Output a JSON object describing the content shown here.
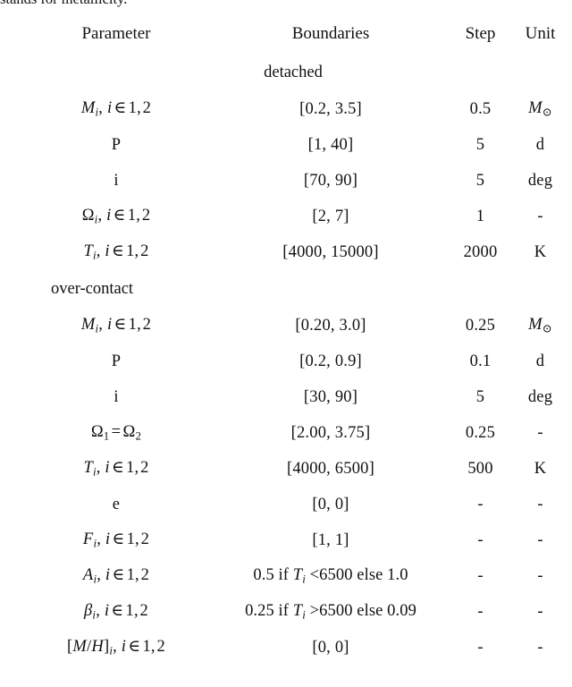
{
  "caption_fragment": "stands for metallicity.",
  "table": {
    "columns": [
      "Parameter",
      "Boundaries",
      "Step",
      "Unit"
    ],
    "sections": [
      {
        "label": "detached",
        "label_align": "center",
        "rows": [
          {
            "parameter_html": "M_i_set",
            "parameter_text": "M_i, i ∈ 1,2",
            "boundaries": "[0.2, 3.5]",
            "step": "0.5",
            "unit": "M_sun"
          },
          {
            "parameter_html": "P",
            "parameter_text": "P",
            "boundaries": "[1, 40]",
            "step": "5",
            "unit": "d"
          },
          {
            "parameter_html": "i",
            "parameter_text": "i",
            "boundaries": "[70, 90]",
            "step": "5",
            "unit": "deg"
          },
          {
            "parameter_html": "Omega_i_set",
            "parameter_text": "Ω_i, i ∈ 1,2",
            "boundaries": "[2, 7]",
            "step": "1",
            "unit": "-"
          },
          {
            "parameter_html": "T_i_set",
            "parameter_text": "T_i, i ∈ 1,2",
            "boundaries": "[4000, 15000]",
            "step": "2000",
            "unit": "K"
          }
        ]
      },
      {
        "label": "over-contact",
        "label_align": "left",
        "rows": [
          {
            "parameter_html": "M_i_set",
            "parameter_text": "M_i, i ∈ 1,2",
            "boundaries": "[0.20, 3.0]",
            "step": "0.25",
            "unit": "M_sun"
          },
          {
            "parameter_html": "P",
            "parameter_text": "P",
            "boundaries": "[0.2, 0.9]",
            "step": "0.1",
            "unit": "d"
          },
          {
            "parameter_html": "i",
            "parameter_text": "i",
            "boundaries": "[30, 90]",
            "step": "5",
            "unit": "deg"
          },
          {
            "parameter_html": "Omega_eq",
            "parameter_text": "Ω_1 = Ω_2",
            "boundaries": "[2.00, 3.75]",
            "step": "0.25",
            "unit": "-"
          },
          {
            "parameter_html": "T_i_set",
            "parameter_text": "T_i, i ∈ 1,2",
            "boundaries": "[4000, 6500]",
            "step": "500",
            "unit": "K"
          }
        ]
      },
      {
        "label": "",
        "label_align": "none",
        "rows": [
          {
            "parameter_html": "e",
            "parameter_text": "e",
            "boundaries": "[0, 0]",
            "step": "-",
            "unit": "-"
          },
          {
            "parameter_html": "F_i_set",
            "parameter_text": "F_i, i ∈ 1,2",
            "boundaries": "[1, 1]",
            "step": "-",
            "unit": "-"
          },
          {
            "parameter_html": "A_i_set",
            "parameter_text": "A_i, i ∈ 1,2",
            "boundaries": "0.5 if T_i <6500 else 1.0",
            "step": "-",
            "unit": "-"
          },
          {
            "parameter_html": "beta_i_set",
            "parameter_text": "β_i, i ∈ 1,2",
            "boundaries": "0.25 if T_i >6500 else 0.09",
            "step": "-",
            "unit": "-"
          },
          {
            "parameter_html": "MH_i_set",
            "parameter_text": "[M/H]_i, i ∈ 1,2",
            "boundaries": "[0, 0]",
            "step": "-",
            "unit": "-"
          }
        ]
      }
    ]
  }
}
